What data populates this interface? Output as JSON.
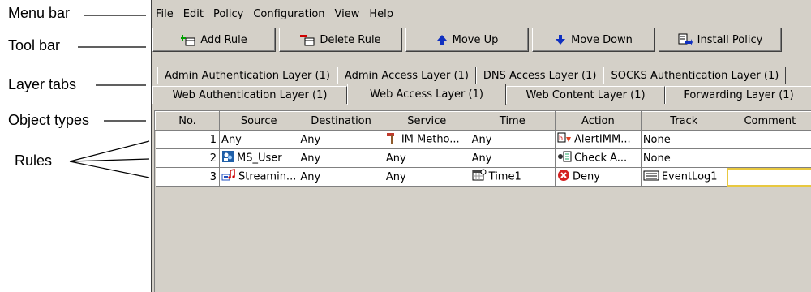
{
  "callouts": {
    "menu_bar": "Menu bar",
    "tool_bar": "Tool bar",
    "layer_tabs": "Layer tabs",
    "object_types": "Object types",
    "rules": "Rules"
  },
  "menu": [
    {
      "label": "File"
    },
    {
      "label": "Edit"
    },
    {
      "label": "Policy"
    },
    {
      "label": "Configuration"
    },
    {
      "label": "View"
    },
    {
      "label": "Help"
    }
  ],
  "toolbar": {
    "add_rule": "Add Rule",
    "delete_rule": "Delete Rule",
    "move_up": "Move Up",
    "move_down": "Move Down",
    "install_policy": "Install Policy"
  },
  "tabs": {
    "back_row": [
      "Admin Authentication Layer (1)",
      "Admin Access Layer (1)",
      "DNS Access Layer (1)",
      "SOCKS Authentication Layer (1)"
    ],
    "front_row": [
      "Web Authentication Layer (1)",
      "Web Access Layer (1)",
      "Web Content Layer (1)",
      "Forwarding Layer (1)"
    ],
    "active": "Web Access Layer (1)"
  },
  "table": {
    "columns": [
      "No.",
      "Source",
      "Destination",
      "Service",
      "Time",
      "Action",
      "Track",
      "Comment"
    ],
    "rows": [
      {
        "no": "1",
        "source": "Any",
        "destination": "Any",
        "service": "IM Metho...",
        "time": "Any",
        "action": "AlertIMM...",
        "track": "None",
        "comment": ""
      },
      {
        "no": "2",
        "source": "MS_User",
        "destination": "Any",
        "service": "Any",
        "time": "Any",
        "action": "Check A...",
        "track": "None",
        "comment": ""
      },
      {
        "no": "3",
        "source": "Streamin...",
        "destination": "Any",
        "service": "Any",
        "time": "Time1",
        "action": "Deny",
        "track": "EventLog1",
        "comment": ""
      }
    ]
  }
}
